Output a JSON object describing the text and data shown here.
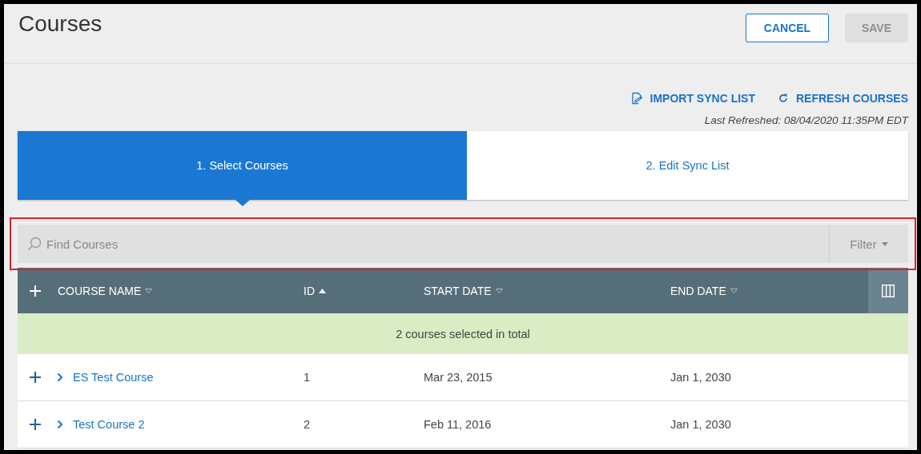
{
  "header": {
    "title": "Courses",
    "buttons": [
      {
        "label": "CANCEL",
        "disabled": false
      },
      {
        "label": "SAVE",
        "disabled": true
      }
    ]
  },
  "actions": [
    {
      "kind": "import",
      "label": "IMPORT SYNC LIST"
    },
    {
      "kind": "refresh",
      "label": "REFRESH COURSES"
    }
  ],
  "last_refreshed": "Last Refreshed: 08/04/2020 11:35PM EDT",
  "steps": [
    {
      "label": "1. Select Courses",
      "selected": true
    },
    {
      "label": "2. Edit Sync List",
      "selected": false
    }
  ],
  "search": {
    "placeholder": "Find Courses",
    "highlighted": true,
    "filter_label": "Filter"
  },
  "table": {
    "columns": [
      {
        "label": "COURSE NAME",
        "sorted": false
      },
      {
        "label": "ID",
        "sorted": true
      },
      {
        "label": "START DATE",
        "sorted": false
      },
      {
        "label": "END DATE",
        "sorted": false
      }
    ],
    "summary": "2 courses selected in total",
    "rows": [
      {
        "cells": [
          "ES Test Course",
          "1",
          "Mar 23, 2015",
          "Jan 1, 2030"
        ],
        "expanded": false
      },
      {
        "cells": [
          "Test Course 2",
          "2",
          "Feb 11, 2016",
          "Jan 1, 2030"
        ],
        "expanded": false
      }
    ]
  }
}
